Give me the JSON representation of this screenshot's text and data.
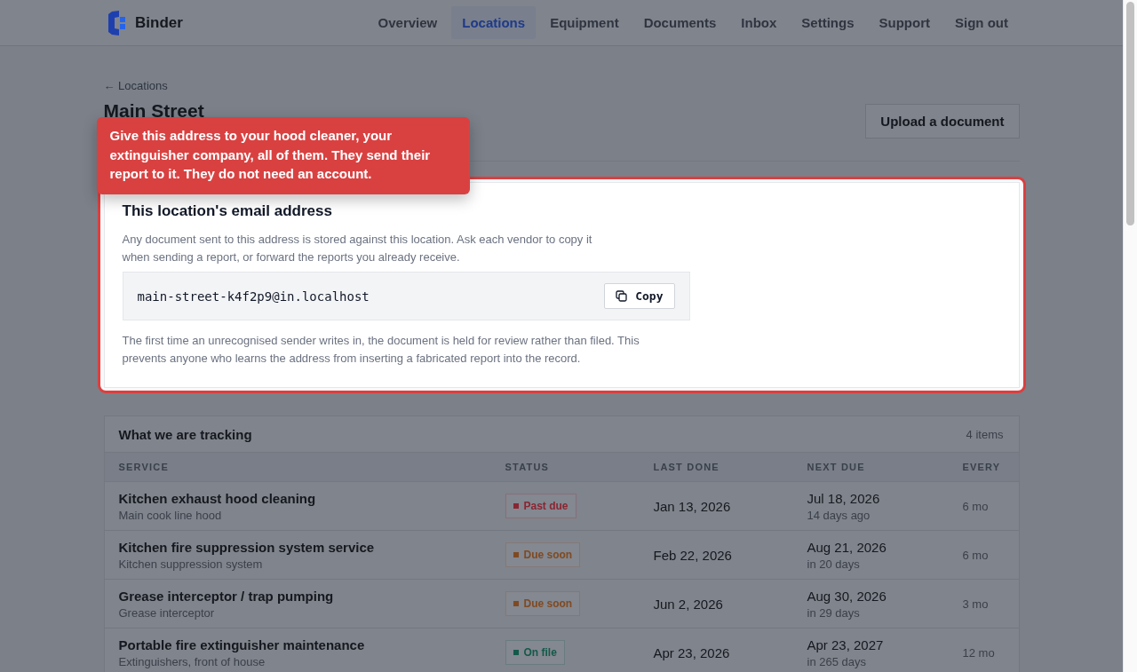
{
  "app": {
    "name": "Binder"
  },
  "nav": [
    {
      "label": "Overview",
      "selected": false
    },
    {
      "label": "Locations",
      "selected": true
    },
    {
      "label": "Equipment",
      "selected": false
    },
    {
      "label": "Documents",
      "selected": false
    },
    {
      "label": "Inbox",
      "selected": false
    },
    {
      "label": "Settings",
      "selected": false
    },
    {
      "label": "Support",
      "selected": false
    },
    {
      "label": "Sign out",
      "selected": false
    }
  ],
  "back_link": "← Locations",
  "page_title": "Main Street",
  "upload_button": "Upload a document",
  "callout": {
    "text": "Give this address to your hood cleaner, your extinguisher company, all of them. They send their report to it. They do not need an account."
  },
  "email_card": {
    "title": "This location's email address",
    "description": "Any document sent to this address is stored against this location. Ask each vendor to copy it when sending a report, or forward the reports you already receive.",
    "address": "main-street-k4f2p9@in.localhost",
    "copy_button": "Copy",
    "note": "The first time an unrecognised sender writes in, the document is held for review rather than filed. This prevents anyone who learns the address from inserting a fabricated report into the record."
  },
  "tracking": {
    "title": "What we are tracking",
    "count": "4 items",
    "columns": [
      "SERVICE",
      "STATUS",
      "LAST DONE",
      "NEXT DUE",
      "EVERY"
    ],
    "rows": [
      {
        "service": "Kitchen exhaust hood cleaning",
        "asset": "Main cook line hood",
        "status": {
          "label": "Past due",
          "color": "#8a2533"
        },
        "last_done": "Jan 13, 2026",
        "next_due": "Jul 18, 2026",
        "due_relative": "14 days ago",
        "every": "6 mo"
      },
      {
        "service": "Kitchen fire suppression system service",
        "asset": "Kitchen suppression system",
        "status": {
          "label": "Due soon",
          "color": "#7f4a22"
        },
        "last_done": "Feb 22, 2026",
        "next_due": "Aug 21, 2026",
        "due_relative": "in 20 days",
        "every": "6 mo"
      },
      {
        "service": "Grease interceptor / trap pumping",
        "asset": "Grease interceptor",
        "status": {
          "label": "Due soon",
          "color": "#7f4a22"
        },
        "last_done": "Jun 2, 2026",
        "next_due": "Aug 30, 2026",
        "due_relative": "in 29 days",
        "every": "3 mo"
      },
      {
        "service": "Portable fire extinguisher maintenance",
        "asset": "Extinguishers, front of house",
        "status": {
          "label": "On file",
          "color": "#14594a"
        },
        "last_done": "Apr 23, 2026",
        "next_due": "Apr 23, 2027",
        "due_relative": "in 265 days",
        "every": "12 mo"
      }
    ]
  }
}
